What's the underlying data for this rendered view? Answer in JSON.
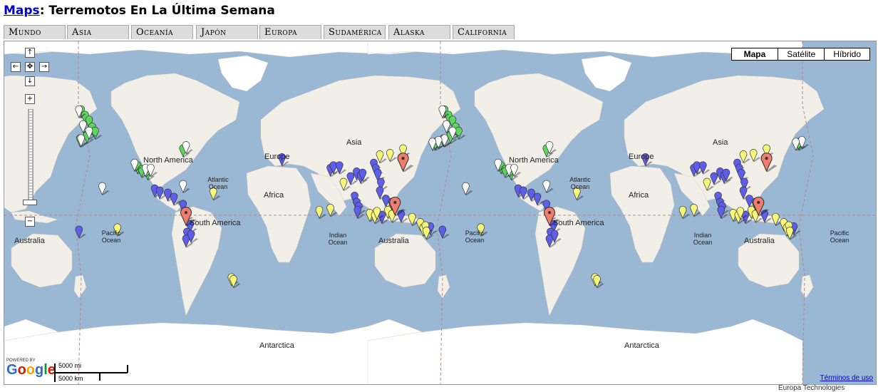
{
  "header": {
    "maps_link": "Maps",
    "title_rest": ": Terremotos En La Última Semana"
  },
  "tabs": [
    "Mundo",
    "Asia",
    "Oceanía",
    "Japón",
    "Europa",
    "Sudamérica",
    "Alaska",
    "California"
  ],
  "map_type": {
    "options": [
      "Mapa",
      "Satélite",
      "Híbrido"
    ],
    "selected": "Mapa"
  },
  "controls": {
    "pan_up": "↑",
    "pan_down": "↓",
    "pan_left": "←",
    "pan_right": "→",
    "center": "✥",
    "zoom_in": "+",
    "zoom_out": "−"
  },
  "labels": {
    "north_america": "North America",
    "north_america_2": "North America",
    "south_america": "South America",
    "south_america_2": "South America",
    "asia": "Asia",
    "asia_2": "Asia",
    "europe": "Europe",
    "europe_2": "Europe",
    "africa": "Africa",
    "africa_2": "Africa",
    "australia": "Australia",
    "australia_2": "Australia",
    "australia_3": "Australia",
    "antarctica": "Antarctica",
    "antarctica_2": "Antarctica",
    "atlantic": "Atlantic Ocean",
    "atlantic_2": "Atlantic Ocean",
    "pacific": "Pacific Ocean",
    "pacific_2": "Pacific Ocean",
    "pacific_3": "Pacific Ocean",
    "indian": "Indian Ocean",
    "indian_2": "Indian Ocean"
  },
  "footer": {
    "powered_by": "POWERED BY",
    "google": "Google",
    "scale_mi": "5000 mi",
    "scale_km": "5000 km",
    "terms": "Términos de uso",
    "copyright": "Europa Technologies"
  },
  "colors": {
    "ocean": "#9ab7d3",
    "land": "#f2efe9",
    "ice": "#ffffff",
    "blue_marker": "#5e5ee8",
    "yellow_marker": "#f7f77a",
    "green_marker": "#5cd65c",
    "white_marker": "#ffffff",
    "red_marker": "#f07c6c"
  },
  "markers": [
    {
      "color": "blue",
      "lon": 23,
      "lat": 44
    },
    {
      "color": "blue",
      "lon": 71,
      "lat": 36
    },
    {
      "color": "blue",
      "lon": 74,
      "lat": 38
    },
    {
      "color": "blue",
      "lon": 80,
      "lat": 38
    },
    {
      "color": "blue",
      "lon": 91,
      "lat": 29
    },
    {
      "color": "blue",
      "lon": 97,
      "lat": 33
    },
    {
      "color": "blue",
      "lon": 101,
      "lat": 30
    },
    {
      "color": "blue",
      "lon": 103,
      "lat": 32
    },
    {
      "color": "blue",
      "lon": 114,
      "lat": 40
    },
    {
      "color": "blue",
      "lon": 116,
      "lat": 36
    },
    {
      "color": "blue",
      "lon": 118,
      "lat": 32
    },
    {
      "color": "blue",
      "lon": 121,
      "lat": 24
    },
    {
      "color": "blue",
      "lon": 120,
      "lat": 16
    },
    {
      "color": "blue",
      "lon": 126,
      "lat": 8
    },
    {
      "color": "blue",
      "lon": 132,
      "lat": 5
    },
    {
      "color": "blue",
      "lon": 141,
      "lat": -7
    },
    {
      "color": "blue",
      "lon": 122,
      "lat": -8
    },
    {
      "color": "blue",
      "lon": 95,
      "lat": 11
    },
    {
      "color": "blue",
      "lon": 97,
      "lat": 5
    },
    {
      "color": "blue",
      "lon": 99,
      "lat": 1
    },
    {
      "color": "blue",
      "lon": 98,
      "lat": -3
    },
    {
      "color": "blue",
      "lon": 170,
      "lat": -19
    },
    {
      "color": "blue",
      "lon": -178,
      "lat": -22
    },
    {
      "color": "blue",
      "lon": -103,
      "lat": 18
    },
    {
      "color": "blue",
      "lon": -98,
      "lat": 16
    },
    {
      "color": "blue",
      "lon": -90,
      "lat": 14
    },
    {
      "color": "blue",
      "lon": -84,
      "lat": 10
    },
    {
      "color": "blue",
      "lon": -75,
      "lat": 3
    },
    {
      "color": "blue",
      "lon": -72,
      "lat": -6
    },
    {
      "color": "blue",
      "lon": -68,
      "lat": -17
    },
    {
      "color": "blue",
      "lon": -71,
      "lat": -24
    },
    {
      "color": "blue",
      "lon": -72,
      "lat": -30
    },
    {
      "color": "blue",
      "lon": -67,
      "lat": -26
    },
    {
      "color": "yellow",
      "lon": 84,
      "lat": 24
    },
    {
      "color": "yellow",
      "lon": 60,
      "lat": -3
    },
    {
      "color": "yellow",
      "lon": 71,
      "lat": -1
    },
    {
      "color": "yellow",
      "lon": 110,
      "lat": -6
    },
    {
      "color": "yellow",
      "lon": 115,
      "lat": -8
    },
    {
      "color": "yellow",
      "lon": 117,
      "lat": -4
    },
    {
      "color": "yellow",
      "lon": 128,
      "lat": -3
    },
    {
      "color": "yellow",
      "lon": 132,
      "lat": -7
    },
    {
      "color": "yellow",
      "lon": 120,
      "lat": 46
    },
    {
      "color": "yellow",
      "lon": 130,
      "lat": 47
    },
    {
      "color": "yellow",
      "lon": 143,
      "lat": 50
    },
    {
      "color": "yellow",
      "lon": 152,
      "lat": -10
    },
    {
      "color": "yellow",
      "lon": 160,
      "lat": -15
    },
    {
      "color": "yellow",
      "lon": 163,
      "lat": -20
    },
    {
      "color": "yellow",
      "lon": 165,
      "lat": -18
    },
    {
      "color": "yellow",
      "lon": 166,
      "lat": -23
    },
    {
      "color": "yellow",
      "lon": -140,
      "lat": -20
    },
    {
      "color": "yellow",
      "lon": -45,
      "lat": 15
    },
    {
      "color": "yellow",
      "lon": -27,
      "lat": -57
    },
    {
      "color": "yellow",
      "lon": -25,
      "lat": -58
    },
    {
      "color": "green",
      "lon": -176,
      "lat": 69
    },
    {
      "color": "green",
      "lon": -172,
      "lat": 67
    },
    {
      "color": "green",
      "lon": -168,
      "lat": 65
    },
    {
      "color": "green",
      "lon": -165,
      "lat": 62
    },
    {
      "color": "green",
      "lon": -162,
      "lat": 60
    },
    {
      "color": "green",
      "lon": -170,
      "lat": 58
    },
    {
      "color": "green",
      "lon": -177,
      "lat": 56
    },
    {
      "color": "green",
      "lon": 175,
      "lat": 54
    },
    {
      "color": "green",
      "lon": -120,
      "lat": 38
    },
    {
      "color": "green",
      "lon": -116,
      "lat": 35
    },
    {
      "color": "green",
      "lon": -110,
      "lat": 33
    },
    {
      "color": "green",
      "lon": -75,
      "lat": 50
    },
    {
      "color": "white",
      "lon": -178,
      "lat": 69
    },
    {
      "color": "white",
      "lon": -174,
      "lat": 63
    },
    {
      "color": "white",
      "lon": -168,
      "lat": 60
    },
    {
      "color": "white",
      "lon": -176,
      "lat": 56
    },
    {
      "color": "white",
      "lon": 178,
      "lat": 55
    },
    {
      "color": "white",
      "lon": 172,
      "lat": 54
    },
    {
      "color": "white",
      "lon": -155,
      "lat": 20
    },
    {
      "color": "white",
      "lon": -123,
      "lat": 40
    },
    {
      "color": "white",
      "lon": -112,
      "lat": 36
    },
    {
      "color": "white",
      "lon": -107,
      "lat": 36
    },
    {
      "color": "white",
      "lon": -75,
      "lat": 22
    },
    {
      "color": "white",
      "lon": -72,
      "lat": 52
    },
    {
      "color": "red",
      "lon": 143,
      "lat": 40
    },
    {
      "color": "red",
      "lon": 135,
      "lat": 0
    },
    {
      "color": "red",
      "lon": -72,
      "lat": -10
    }
  ]
}
